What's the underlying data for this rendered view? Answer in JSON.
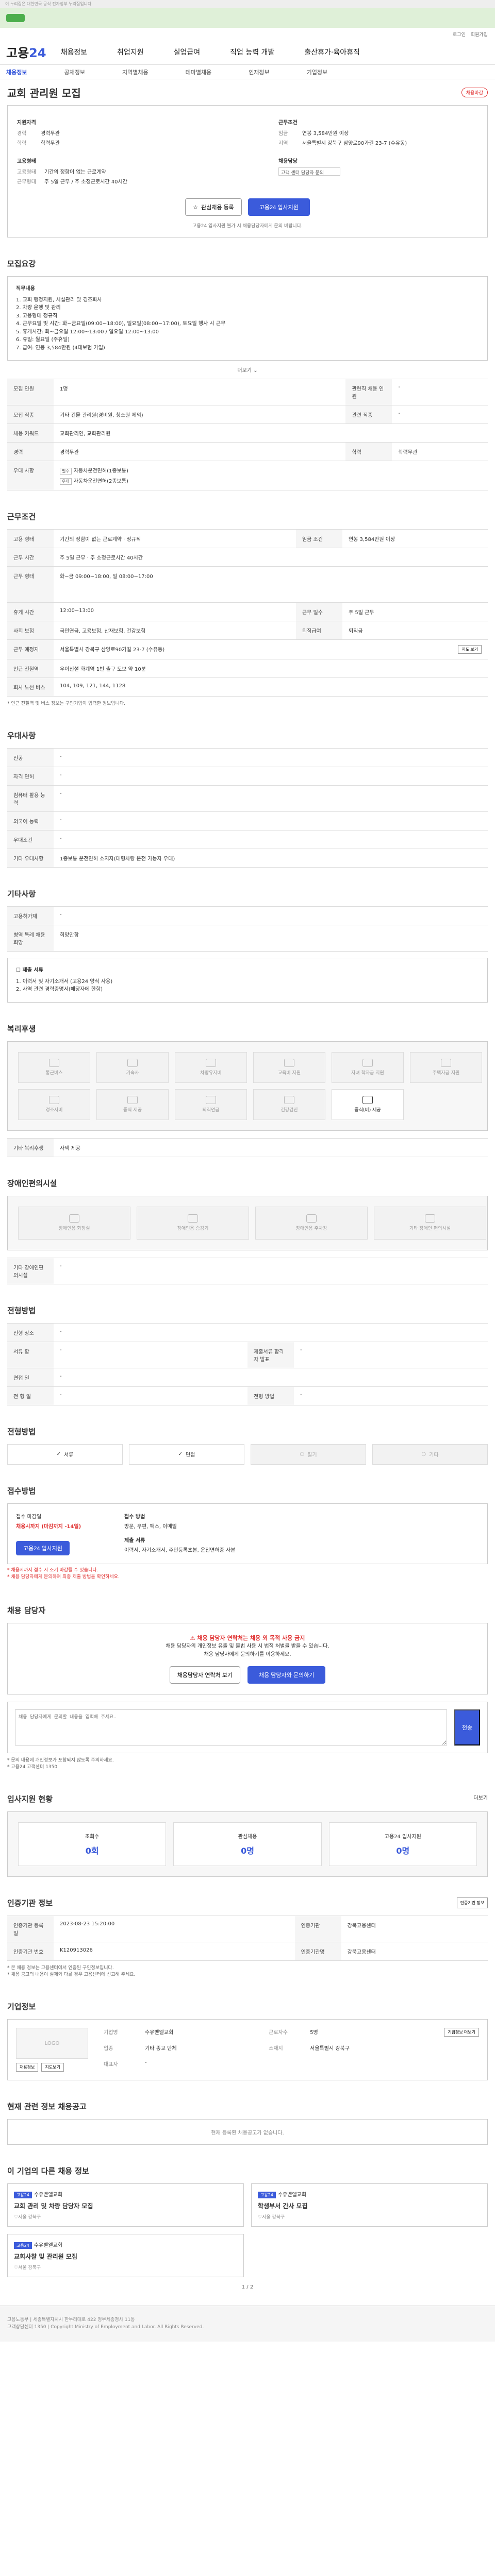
{
  "topbar": {
    "notice": "이 누리집은 대한민국 공식 전자정부 누리집입니다."
  },
  "util": {
    "links": [
      "로그인",
      "회원가입"
    ]
  },
  "gnb": {
    "logo_main": "고용",
    "logo_accent": "24",
    "menu": [
      "채용정보",
      "취업지원",
      "실업급여",
      "직업 능력 개발",
      "출산휴가·육아휴직"
    ]
  },
  "subnav": {
    "items": [
      "채용정보",
      "공채정보",
      "지역별채용",
      "테마별채용",
      "인재정보",
      "기업정보"
    ]
  },
  "page": {
    "title": "교회 관리원 모집",
    "tag": "채용마감"
  },
  "summary": {
    "employer_heading": "지원자격",
    "employer": [
      {
        "k": "경력",
        "v": "경력무관"
      },
      {
        "k": "학력",
        "v": "학력무관"
      }
    ],
    "condition_heading": "근무조건",
    "condition": [
      {
        "k": "임금",
        "v": "연봉 3,584만원 이상"
      },
      {
        "k": "지역",
        "v": "서울특별시 강북구 삼양로90가길 23-7 (수유동)"
      }
    ],
    "form_heading": "고용형태",
    "form": [
      {
        "k": "고용형태",
        "v": "기간의 정함이 없는 근로계약"
      },
      {
        "k": "근무형태",
        "v": "주 5일 근무 / 주 소정근로시간 40시간"
      }
    ],
    "contact_heading": "채용담당",
    "contact_value": "고객 센터 담당자 문의",
    "btn_scrap": "관심채용 등록",
    "btn_apply": "고용24 입사지원",
    "note": "고용24 입사지원 불가 시 채용담당자에게 문의 바랍니다."
  },
  "recruit": {
    "heading": "모집요강",
    "job_title": "직무내용",
    "job_lines": [
      "1. 교회 행정지원, 시설관리 및 경조화사",
      "2. 차량 운행 및 관리",
      "3. 고용형태 정규직",
      "4. 근무요일 및 시간: 화~금요일(09:00~18:00), 일요일(08:00~17:00), 토요일 행사 시 근무",
      "5. 휴게시간: 화~금요일 12:00~13:00 / 일요일 12:00~13:00",
      "6. 휴일: 월요일 (주휴일)",
      "7. 급여: 연봉 3,584만원 (4대보험 가입)"
    ],
    "more": "더보기",
    "rows": [
      {
        "k": "모집 인원",
        "v": "1명",
        "k2": "관련직 채용 인원",
        "v2": "-"
      },
      {
        "k": "모집 직종",
        "v": "기타 건물 관리원(경비원, 청소원 제외)",
        "k2": "관련 직종",
        "v2": "-"
      },
      {
        "k": "채용 키워드",
        "v": "교회관리인, 교회관리원",
        "k2": "",
        "v2": ""
      },
      {
        "k": "경력",
        "v": "경력무관",
        "k2": "학력",
        "v2": "학력무관"
      },
      {
        "k": "우대 사항",
        "v": "자동차운전면허(1종보통)",
        "k2": "",
        "v2": ""
      }
    ],
    "pref_tags": [
      "필수",
      "우대"
    ],
    "pref_extra": "자동차운전면허(2종보통)"
  },
  "work": {
    "heading": "근무조건",
    "rows": [
      {
        "k": "고용 형태",
        "v": "기간의 정함이 없는 근로계약 · 정규직",
        "k2": "임금 조건",
        "v2": "연봉 3,584만원 이상"
      },
      {
        "k": "근무 시간",
        "v": "주 5일 근무 · 주 소정근로시간 40시간",
        "k2": "",
        "v2": ""
      },
      {
        "k": "근무 형태",
        "v": "화~금 09:00~18:00, 일 08:00~17:00",
        "k2": "",
        "v2": ""
      },
      {
        "k": "휴게 시간",
        "v": "12:00~13:00",
        "k2": "근무 일수",
        "v2": "주 5일 근무"
      },
      {
        "k": "사회 보험",
        "v": "국민연금, 고용보험, 산재보험, 건강보험",
        "k2": "퇴직급여",
        "v2": "퇴직금"
      },
      {
        "k": "근무 예정지",
        "v": "서울특별시 강북구 삼양로90가길 23-7 (수유동)",
        "k2": "",
        "v2": ""
      },
      {
        "k": "인근 전철역",
        "v": "우이신설 화계역 1번 출구 도보 약 10분",
        "k2": "",
        "v2": ""
      },
      {
        "k": "회사 노선 버스",
        "v": "104, 109, 121, 144, 1128",
        "k2": "",
        "v2": ""
      }
    ],
    "map_btn": "지도 보기",
    "note": "* 인근 전철역 및 버스 정보는 구인기업이 입력한 정보입니다."
  },
  "etc": {
    "heading": "우대사항",
    "rows": [
      {
        "k": "전공",
        "v": "-"
      },
      {
        "k": "자격 면허",
        "v": "-"
      },
      {
        "k": "컴퓨터 활용 능력",
        "v": "-"
      },
      {
        "k": "외국어 능력",
        "v": "-"
      },
      {
        "k": "우대조건",
        "v": "-"
      },
      {
        "k": "기타 우대사항",
        "v": "1종보통 운전면허 소지자(대형차량 운전 가능자 우대)"
      }
    ]
  },
  "other": {
    "heading": "기타사항",
    "rows": [
      {
        "k": "고용허가제",
        "v": "-"
      },
      {
        "k": "병역 특례 채용 희망",
        "v": "희망안함"
      }
    ],
    "docs_title": "제출 서류",
    "doc_lines": [
      "1. 이력서 및 자기소개서 (고용24 양식 사용)",
      "2. 사역 관련 경력증명서(해당자에 한함)"
    ]
  },
  "welfare": {
    "heading": "복리후생",
    "items": [
      {
        "label": "통근버스",
        "on": false
      },
      {
        "label": "기숙사",
        "on": false
      },
      {
        "label": "차량유지비",
        "on": false
      },
      {
        "label": "교육비 지원",
        "on": false
      },
      {
        "label": "자녀 학자금 지원",
        "on": false
      },
      {
        "label": "주택자금 지원",
        "on": false
      },
      {
        "label": "경조사비",
        "on": false
      },
      {
        "label": "중식 제공",
        "on": false
      },
      {
        "label": "퇴직연금",
        "on": false
      },
      {
        "label": "건강검진",
        "on": false
      },
      {
        "label": "중식(비) 제공",
        "on": true
      }
    ],
    "extra_label": "기타 복리후생",
    "extra_value": "사택 제공"
  },
  "disabled": {
    "heading": "장애인편의시설",
    "items": [
      {
        "label": "장애인용 화장실",
        "on": false
      },
      {
        "label": "장애인용 승강기",
        "on": false
      },
      {
        "label": "장애인용 주차장",
        "on": false
      },
      {
        "label": "기타 장애인 편의시설",
        "on": false
      }
    ],
    "extra_label": "기타 장애인편의시설",
    "extra_value": "-"
  },
  "process": {
    "heading": "전형방법",
    "rows": [
      {
        "k": "전형 장소",
        "v": "-",
        "k2": "",
        "v2": ""
      },
      {
        "k": "서류 합",
        "v": "-",
        "k2": "제출서류 합격자 발표",
        "v2": "-"
      },
      {
        "k": "면접 일",
        "v": "-",
        "k2": "",
        "v2": ""
      },
      {
        "k": "전 형 일",
        "v": "-",
        "k2": "전형 방법",
        "v2": "-"
      }
    ],
    "steps": [
      {
        "label": "서류",
        "on": true
      },
      {
        "label": "면접",
        "on": true
      },
      {
        "label": "필기",
        "on": false
      },
      {
        "label": "기타",
        "on": false
      }
    ]
  },
  "apply": {
    "heading": "접수방법",
    "deadline_label": "접수 마감일",
    "deadline_value": "채용시까지 (마감까지 -14일)",
    "method_label": "접수 방법",
    "method_value": "방문, 우편, 팩스, 이메일",
    "doc_label": "제출 서류",
    "doc_value": "이력서, 자기소개서, 주민등록초본, 운전면허증 사본",
    "apply_btn": "고용24 입사지원",
    "red_notes": [
      "* 채용시까지 접수 시 조기 마감될 수 있습니다.",
      "* 채용 담당자에게 문의하여 최종 제출 방법을 확인하세요."
    ]
  },
  "manager": {
    "heading": "채용 담당자",
    "warn_title": "채용 담당자 연락처는 채용 외 목적 사용 금지",
    "warn_lines": [
      "채용 담당자의 개인정보 유출 및 불법 사용 시 법적 처벌을 받을 수 있습니다.",
      "채용 담당자에게 문의하기를 이용하세요."
    ],
    "btn_contact": "채용담당자 연락처 보기",
    "btn_qna": "채용 담당자와 문의하기",
    "qa_placeholder": "채용 담당자에게 문의할 내용을 입력해 주세요.",
    "qa_send": "전송",
    "notes": [
      "* 문의 내용에 개인정보가 포함되지 않도록 주의하세요.",
      "* 고용24 고객센터 1350"
    ]
  },
  "stats": {
    "heading": "입사지원 현황",
    "more": "더보기",
    "items": [
      {
        "label": "조회수",
        "value": "0회"
      },
      {
        "label": "관심채용",
        "value": "0명"
      },
      {
        "label": "고용24 입사지원",
        "value": "0명"
      }
    ]
  },
  "info": {
    "heading": "인증기관 정보",
    "btn": "인증기관 정보",
    "rows": [
      {
        "k": "인증기관 등록일",
        "v": "2023-08-23 15:20:00",
        "k2": "인증기관",
        "v2": "강북고용센터"
      },
      {
        "k": "인증기관 번호",
        "v": "K120913026",
        "k2": "인증기관명",
        "v2": "강북고용센터"
      }
    ],
    "notes": [
      "* 본 채용 정보는 고용센터에서 인증된 구인정보입니다.",
      "* 채용 공고의 내용이 실제와 다를 경우 고용센터에 신고해 주세요."
    ]
  },
  "company": {
    "heading": "기업정보",
    "logo_label": "LOGO",
    "btn": "기업정보 더보기",
    "fields": [
      {
        "k": "기업명",
        "v": "수유벧엘교회"
      },
      {
        "k": "업종",
        "v": "기타 종교 단체"
      },
      {
        "k": "대표자",
        "v": "-"
      },
      {
        "k": "근로자수",
        "v": "5명"
      },
      {
        "k": "소재지",
        "v": "서울특별시 강북구"
      }
    ],
    "btn_list": "채용정보",
    "btn_map": "지도보기"
  },
  "related": {
    "heading": "현재 관련 정보 채용공고",
    "empty": "현재 등록된 채용공고가 없습니다."
  },
  "similar": {
    "heading": "이 기업의 다른 채용 정보",
    "jobs": [
      {
        "badge": "고용24",
        "company": "수유벧엘교회",
        "title": "교회 관리 및 차량 담당자 모집",
        "meta": "서울 강북구"
      },
      {
        "badge": "고용24",
        "company": "수유벧엘교회",
        "title": "학생부서 간사 모집",
        "meta": "서울 강북구"
      },
      {
        "badge": "고용24",
        "company": "수유벧엘교회",
        "title": "교회사찰 및 관리원 모집",
        "meta": "서울 강북구"
      }
    ],
    "pager": "1 / 2"
  },
  "footer": {
    "lines": [
      "고용노동부 | 세종특별자치시 한누리대로 422 정부세종청사 11동",
      "고객상담센터 1350 | Copyright Ministry of Employment and Labor. All Rights Reserved."
    ]
  }
}
